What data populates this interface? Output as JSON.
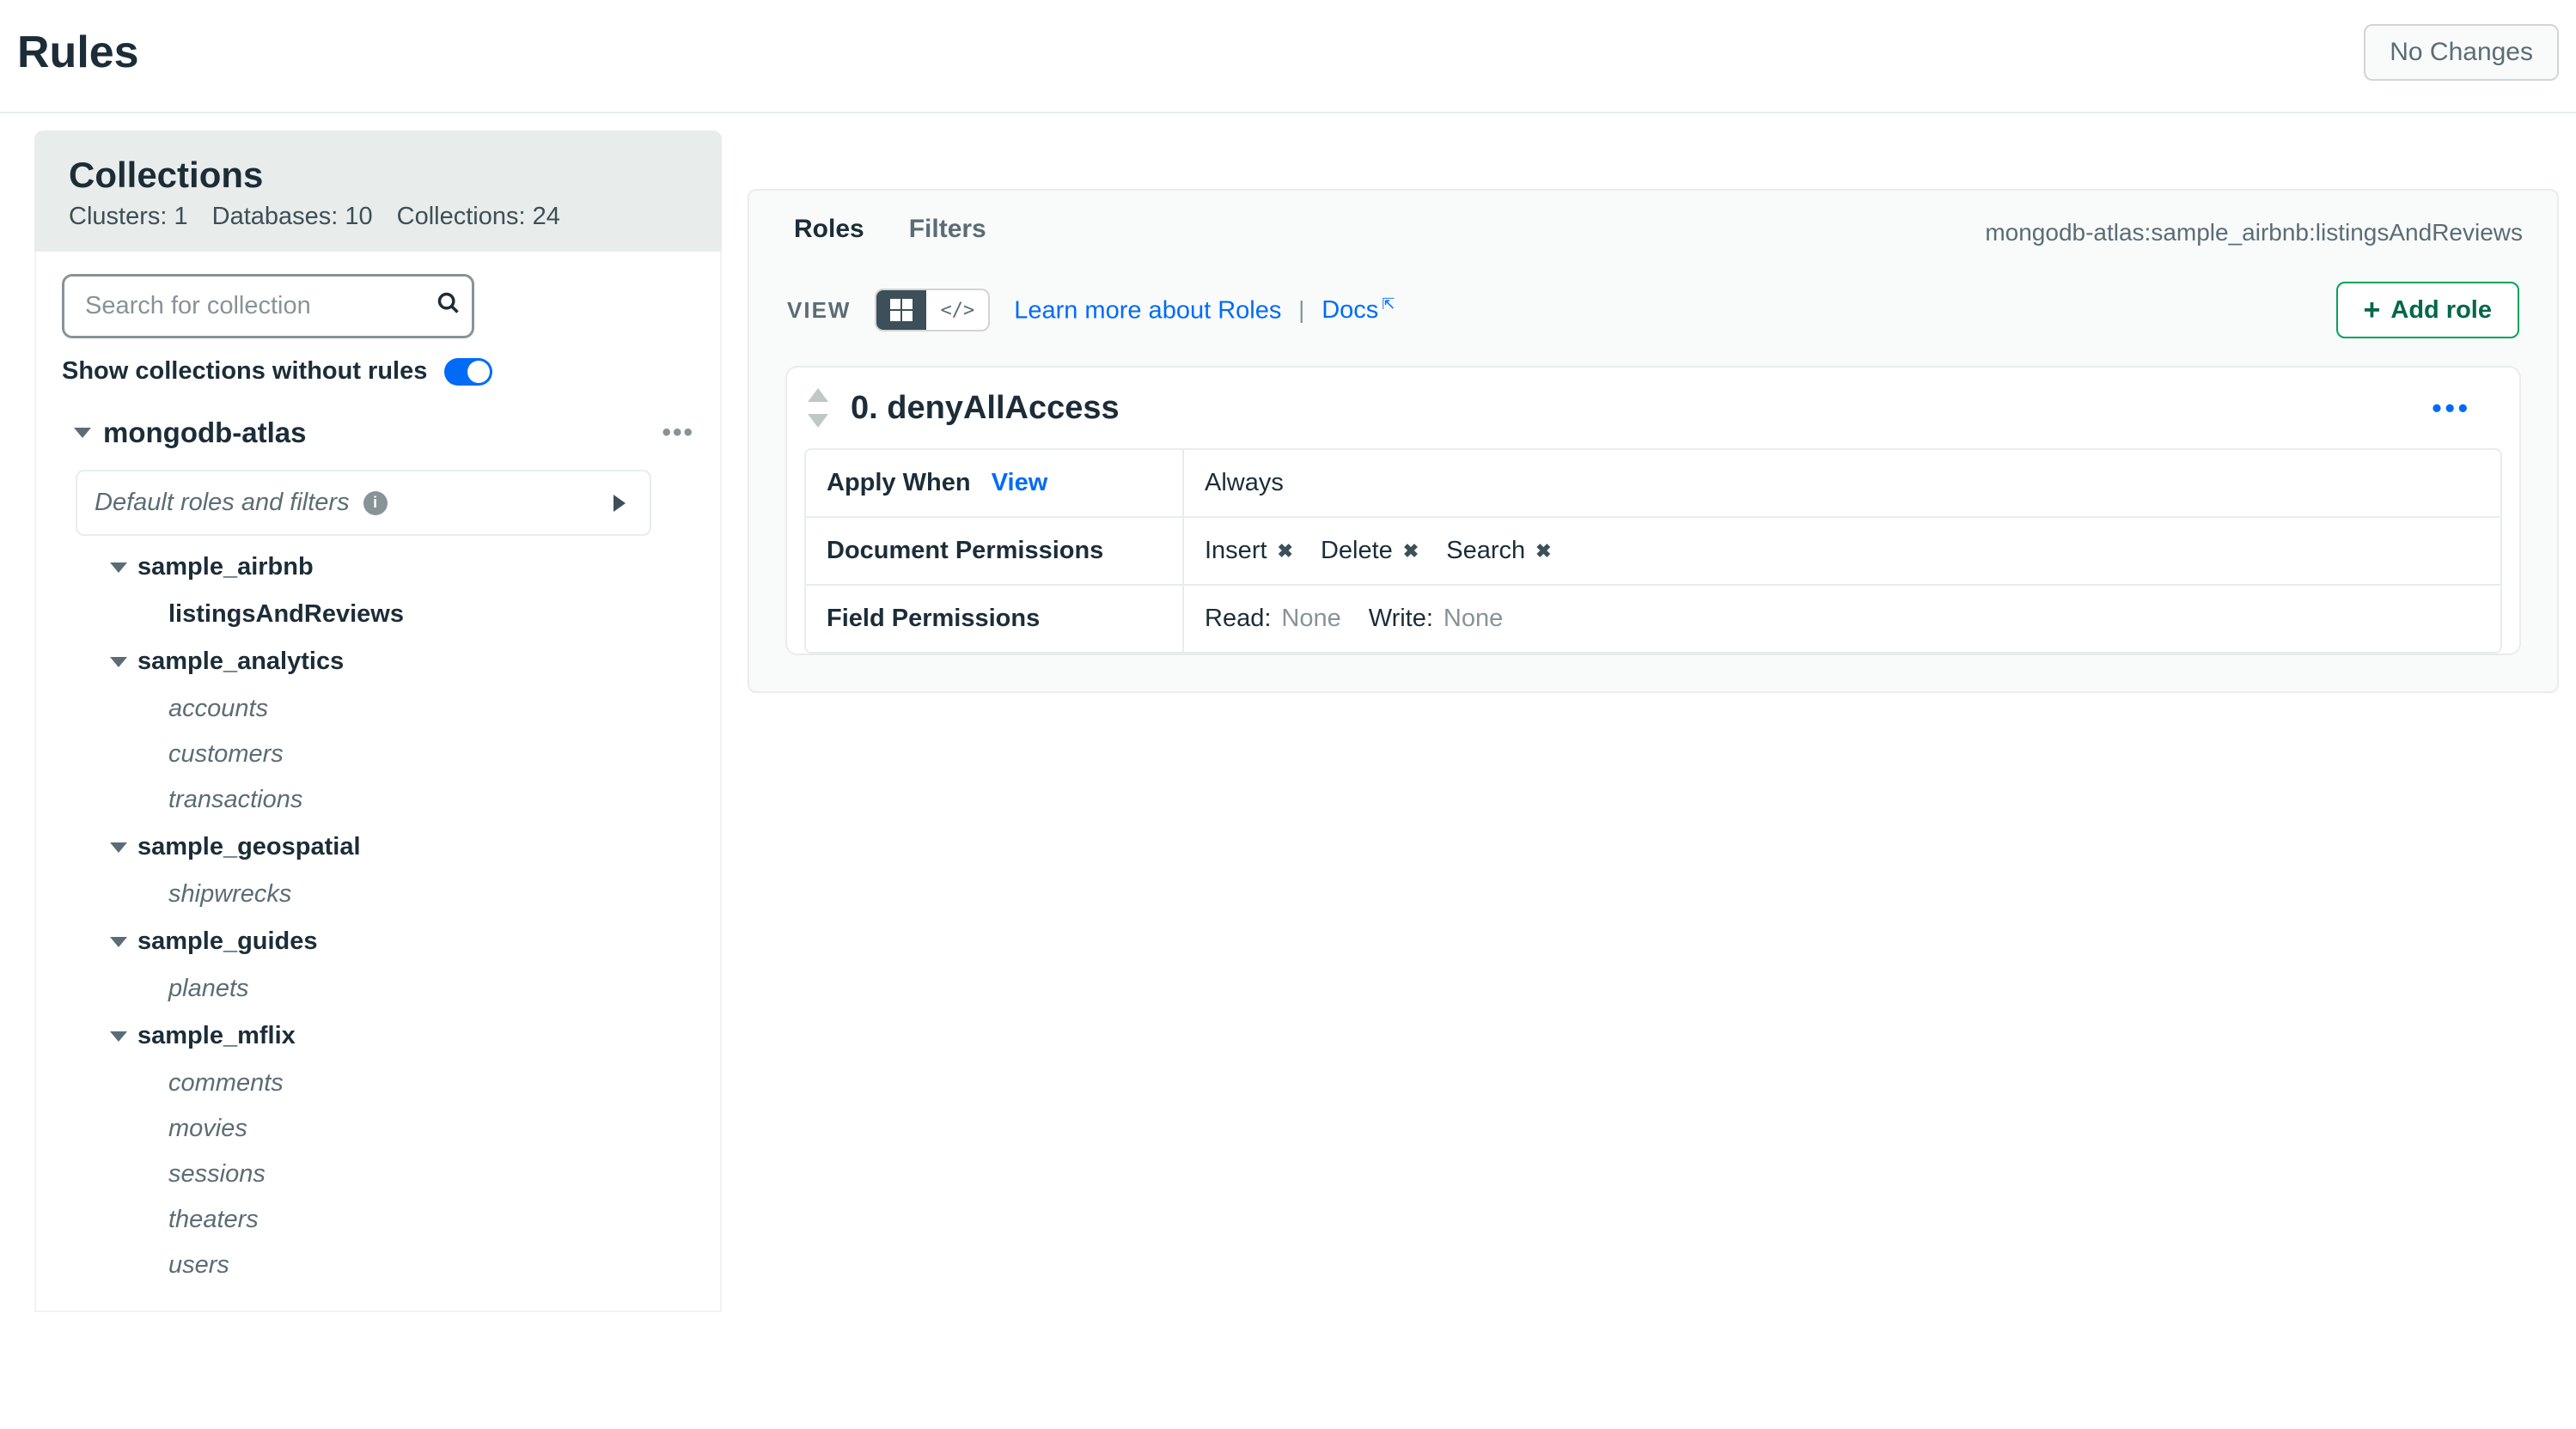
{
  "header": {
    "title": "Rules",
    "noChanges": "No Changes"
  },
  "sidebar": {
    "title": "Collections",
    "clustersLabel": "Clusters:",
    "clustersValue": "1",
    "databasesLabel": "Databases:",
    "databasesValue": "10",
    "collectionsLabel": "Collections:",
    "collectionsValue": "24",
    "searchPlaceholder": "Search for collection",
    "toggleLabel": "Show collections without rules",
    "dataSource": "mongodb-atlas",
    "defaultRolesLabel": "Default roles and filters",
    "databases": [
      {
        "name": "sample_airbnb",
        "collections": [
          "listingsAndReviews"
        ]
      },
      {
        "name": "sample_analytics",
        "collections": [
          "accounts",
          "customers",
          "transactions"
        ]
      },
      {
        "name": "sample_geospatial",
        "collections": [
          "shipwrecks"
        ]
      },
      {
        "name": "sample_guides",
        "collections": [
          "planets"
        ]
      },
      {
        "name": "sample_mflix",
        "collections": [
          "comments",
          "movies",
          "sessions",
          "theaters",
          "users"
        ]
      }
    ]
  },
  "main": {
    "tabs": {
      "roles": "Roles",
      "filters": "Filters"
    },
    "breadcrumb": "mongodb-atlas:sample_airbnb:listingsAndReviews",
    "viewLabel": "VIEW",
    "learnMore": "Learn more about Roles",
    "docs": "Docs",
    "addRole": "Add role",
    "role": {
      "title": "0. denyAllAccess",
      "applyWhenLabel": "Apply When",
      "viewLink": "View",
      "applyWhenValue": "Always",
      "docPermsLabel": "Document Permissions",
      "docPerms": {
        "insert": "Insert",
        "delete": "Delete",
        "search": "Search"
      },
      "fieldPermsLabel": "Field Permissions",
      "readLabel": "Read:",
      "readValue": "None",
      "writeLabel": "Write:",
      "writeValue": "None"
    }
  }
}
